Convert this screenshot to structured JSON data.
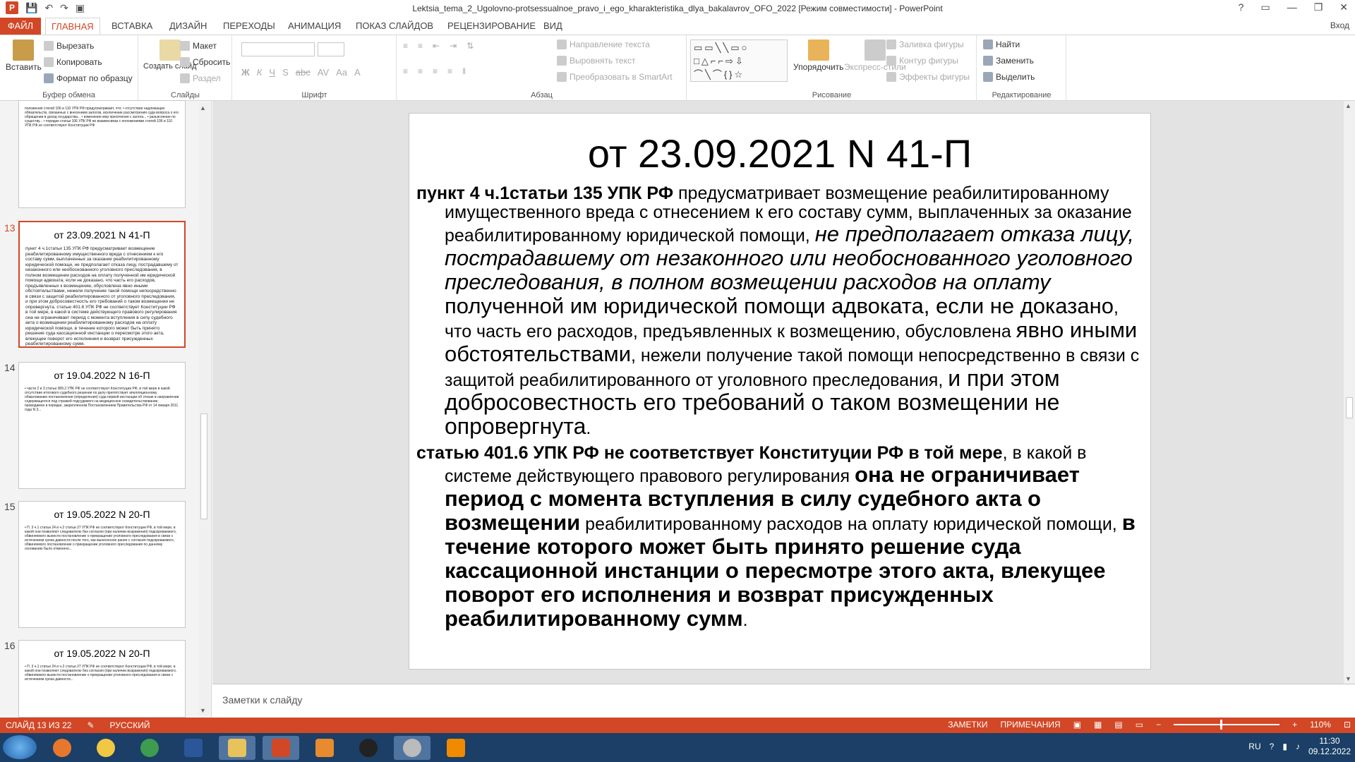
{
  "window": {
    "title": "Lektsia_tema_2_Ugolovno-protsessualnoe_pravo_i_ego_kharakteristika_dlya_bakalavrov_OFO_2022 [Режим совместимости] - PowerPoint",
    "controls": [
      "?",
      "▭",
      "—",
      "❐",
      "✕"
    ]
  },
  "ribbon_tabs": {
    "file": "ФАЙЛ",
    "tabs": [
      "ГЛАВНАЯ",
      "ВСТАВКА",
      "ДИЗАЙН",
      "ПЕРЕХОДЫ",
      "АНИМАЦИЯ",
      "ПОКАЗ СЛАЙДОВ",
      "РЕЦЕНЗИРОВАНИЕ",
      "ВИД"
    ],
    "user": "Вход"
  },
  "ribbon": {
    "clipboard": {
      "paste": "Вставить",
      "cut": "Вырезать",
      "copy": "Копировать",
      "format_painter": "Формат по образцу",
      "label": "Буфер обмена"
    },
    "slides": {
      "new_slide": "Создать слайд",
      "layout": "Макет",
      "reset": "Сбросить",
      "section": "Раздел",
      "label": "Слайды"
    },
    "font": {
      "label": "Шрифт",
      "buttons": [
        "Ж",
        "К",
        "Ч",
        "S",
        "abc",
        "AV",
        "Aa",
        "A"
      ]
    },
    "paragraph": {
      "text_direction": "Направление текста",
      "align_text": "Выровнять текст",
      "smartart": "Преобразовать в SmartArt",
      "label": "Абзац"
    },
    "drawing": {
      "arrange": "Упорядочить",
      "quick_styles": "Экспресс-стили",
      "fill": "Заливка фигуры",
      "outline": "Контур фигуры",
      "effects": "Эффекты фигуры",
      "label": "Рисование"
    },
    "editing": {
      "find": "Найти",
      "replace": "Заменить",
      "select": "Выделить",
      "label": "Редактирование"
    }
  },
  "thumbnails": [
    {
      "num": "",
      "title": "",
      "text": "положения статей 106 и 110 УПК РФ предусматривает, что: • отсутствие надлежащих обязательств, связанных с внесением залогов, исключение рассмотрения суда вопроса о его обращении в доход государства... • изменение мер пресечения с залога... • разъяснение по существу... • порядке статьи 106 УПК РФ во взаимосвязи с положениями статей 106 и 110 УПК РФ не соответствуют Конституции РФ"
    },
    {
      "num": "13",
      "title": "от 23.09.2021 N 41-П",
      "text": "пункт 4 ч.1статьи 135 УПК РФ предусматривает возмещение реабилитированному имущественного вреда с отнесением к его составу сумм, выплаченных за оказание реабилитированному юридической помощи, не предполагает отказа лицу, пострадавшему от незаконного или необоснованного уголовного преследования, в полном возмещении расходов на оплату полученной им юридической помощи адвоката, если не доказано, что часть его расходов, предъявленных к возмещению, обусловлена явно иными обстоятельствами, нежели получение такой помощи непосредственно в связи с защитой реабилитированного от уголовного преследования, и при этом добросовестность его требований о таком возмещении не опровергнута. статью 401.6 УПК РФ не соответствует Конституции РФ в той мере, в какой в системе действующего правового регулирования она не ограничивает период с момента вступления в силу судебного акта о возмещении реабилитированному расходов на оплату юридической помощи, в течение которого может быть принято решение суда кассационной инстанции о пересмотре этого акта, влекущее поворот его исполнения и возврат присужденных реабилитированному сумм."
    },
    {
      "num": "14",
      "title": "от 19.04.2022 N 16-П",
      "text": "• части 2 и 3 статьи 389.2 УПК РФ не соответствуют Конституции РФ, в той мере в какой отсутствие итогового судебного решения по делу препятствует апелляционному обжалованию постановления (определения) суда первой инстанции об отказе в направлении содержащегося под стражей подсудимого на медицинское освидетельствование, проводимое в порядке, закрепленном Постановлением Правительства РФ от 14 января 2011 года N 3..."
    },
    {
      "num": "15",
      "title": "от 19.05.2022 N 20-П",
      "text": "• П. 3 ч.1 статьи 24 и ч.2 статьи 27 УПК РФ не соответствуют Конституции РФ, в той мере, в какой они позволяют следователю без согласия (при наличии возражения) подозреваемого, обвиняемого вынести постановление о прекращении уголовного преследования в связи с истечением срока давности после того, как вынесенное ранее с согласия подозреваемого, обвиняемого постановление о прекращении уголовного преследования по данному основанию было отменено..."
    },
    {
      "num": "16",
      "title": "от 19.05.2022 N 20-П",
      "text": "• П. 3 ч.1 статьи 24 и ч.2 статьи 27 УПК РФ не соответствуют Конституции РФ, в той мере, в какой они позволяют следователю без согласия (при наличии возражения) подозреваемого, обвиняемого вынести постановление о прекращении уголовного преследования в связи с истечением срока давности..."
    }
  ],
  "slide": {
    "title": "от 23.09.2021 N 41-П",
    "p1": {
      "a": "пункт 4 ч.1статьи 135 УПК РФ",
      "b": " предусматривает возмещение реабилитированному имущественного вреда с отнесением к его составу сумм, выплаченных за оказание реабилитированному юридической помощи, ",
      "c": "не предполагает отказа лицу, пострадавшему от незаконного или необоснованного уголовного преследования, в полном возмещении расходов на оплату",
      "d": " полученной им юридической помощи адвоката, если не доказано",
      "e": ", что часть его расходов, предъявленных к возмещению, обусловлена ",
      "f": "явно иными обстоятельствами",
      "g": ", нежели получение такой помощи непосредственно в связи с защитой реабилитированного от уголовного преследования, ",
      "h": "и при этом добросовестность его требований о таком возмещении не опровергнута",
      "i": "."
    },
    "p2": {
      "a": "статью 401.6 УПК РФ не соответствует Конституции РФ в той мере",
      "b": ", в какой в системе действующего правового регулирования ",
      "c": "она не ограничивает период с момента вступления в силу судебного акта о возмещении",
      "d": " реабилитированному расходов на оплату юридической помощи, ",
      "e": "в течение которого может быть принято решение суда кассационной инстанции о пересмотре этого акта, влекущее поворот его исполнения и возврат присужденных реабилитированному сумм",
      "f": "."
    }
  },
  "notes_placeholder": "Заметки к слайду",
  "status": {
    "slide": "СЛАЙД 13 ИЗ 22",
    "lang": "РУССКИЙ",
    "notes": "ЗАМЕТКИ",
    "comments": "ПРИМЕЧАНИЯ",
    "zoom": "110%"
  },
  "tray": {
    "lang": "RU",
    "time": "11:30",
    "date": "09.12.2022"
  },
  "colors": {
    "accent": "#d24726",
    "taskbar": "#1b3f66"
  }
}
